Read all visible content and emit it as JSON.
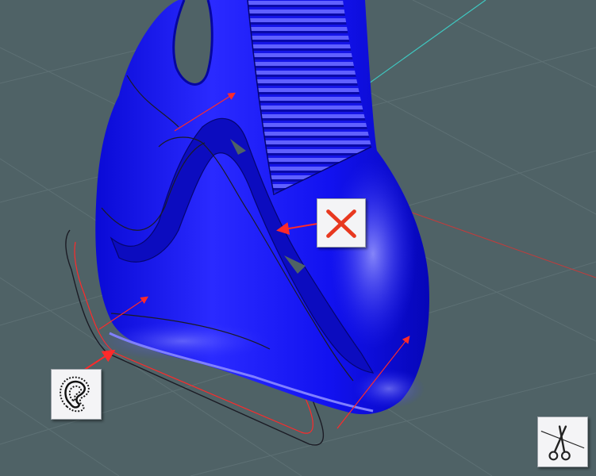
{
  "viewport": {
    "background_color": "#4f6266",
    "grid_color": "#5d7074",
    "axis_x_color": "#c33b3b",
    "axis_y_color": "#3fc7c0",
    "model_color": "#1a1aff",
    "curve_color": "#ff2a2a",
    "edge_color": "#1b1b24"
  },
  "tools": {
    "offset_curve": {
      "icon": "offset-curve-icon"
    },
    "delete": {
      "icon": "delete-x-icon",
      "color": "#e8381f"
    },
    "trim": {
      "icon": "scissors-icon"
    }
  }
}
